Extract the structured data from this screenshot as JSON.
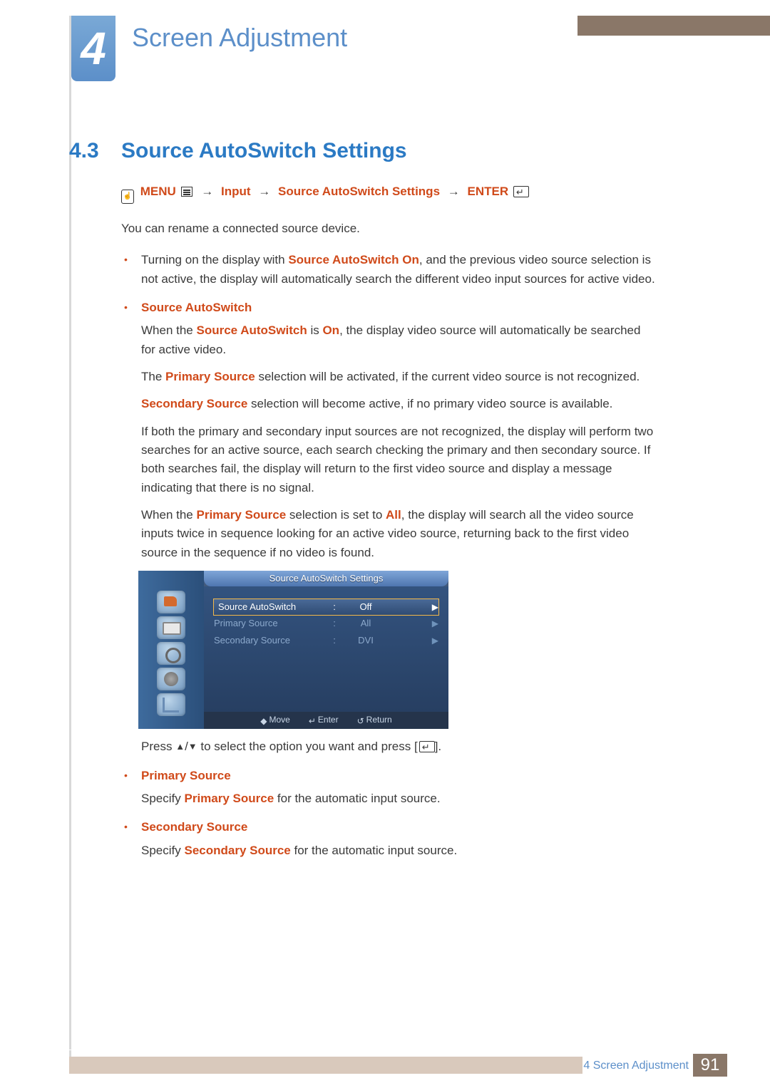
{
  "chapter": {
    "number": "4",
    "title": "Screen Adjustment"
  },
  "section": {
    "number": "4.3",
    "title": "Source AutoSwitch Settings"
  },
  "navpath": {
    "menu": "MENU",
    "p1": "Input",
    "p2": "Source AutoSwitch Settings",
    "enter": "ENTER"
  },
  "intro": "You can rename a connected source device.",
  "bullet1": {
    "pre": "Turning on the display with ",
    "hl": "Source AutoSwitch On",
    "post": ", and the previous video source selection is not active, the display will automatically search the different video input sources for active video."
  },
  "source_autoswitch": {
    "heading": "Source AutoSwitch",
    "p1_a": "When the ",
    "p1_hl1": "Source AutoSwitch",
    "p1_b": " is ",
    "p1_hl2": "On",
    "p1_c": ", the display video source will automatically be searched for active video.",
    "p2_a": "The ",
    "p2_hl": "Primary Source",
    "p2_b": " selection will be activated, if the current video source is not recognized.",
    "p3_hl": "Secondary Source",
    "p3_b": " selection will become active, if no primary video source is available.",
    "p4": "If both the primary and secondary input sources are not recognized, the display will perform two searches for an active source, each search checking the primary and then secondary source. If both searches fail, the display will return to the first video source and display a message indicating that there is no signal.",
    "p5_a": "When the ",
    "p5_hl1": "Primary Source",
    "p5_b": " selection is set to ",
    "p5_hl2": "All",
    "p5_c": ", the display will search all the video source inputs twice in sequence looking for an active video source, returning back to the first video source in the sequence if no video is found."
  },
  "osd": {
    "title": "Source AutoSwitch Settings",
    "rows": [
      {
        "label": "Source AutoSwitch",
        "value": "Off",
        "selected": true
      },
      {
        "label": "Primary Source",
        "value": "All",
        "selected": false
      },
      {
        "label": "Secondary Source",
        "value": "DVI",
        "selected": false
      }
    ],
    "footer": {
      "move": "Move",
      "enter": "Enter",
      "return": "Return"
    }
  },
  "press_line": {
    "a": "Press  ",
    "b": "  to select the option you want and press [",
    "c": "]."
  },
  "primary": {
    "heading": "Primary Source",
    "a": "Specify ",
    "hl": "Primary Source",
    "b": " for the automatic input source."
  },
  "secondary": {
    "heading": "Secondary Source",
    "a": "Specify ",
    "hl": "Secondary Source",
    "b": " for the automatic input source."
  },
  "footer": {
    "label": "4 Screen Adjustment",
    "page": "91"
  }
}
